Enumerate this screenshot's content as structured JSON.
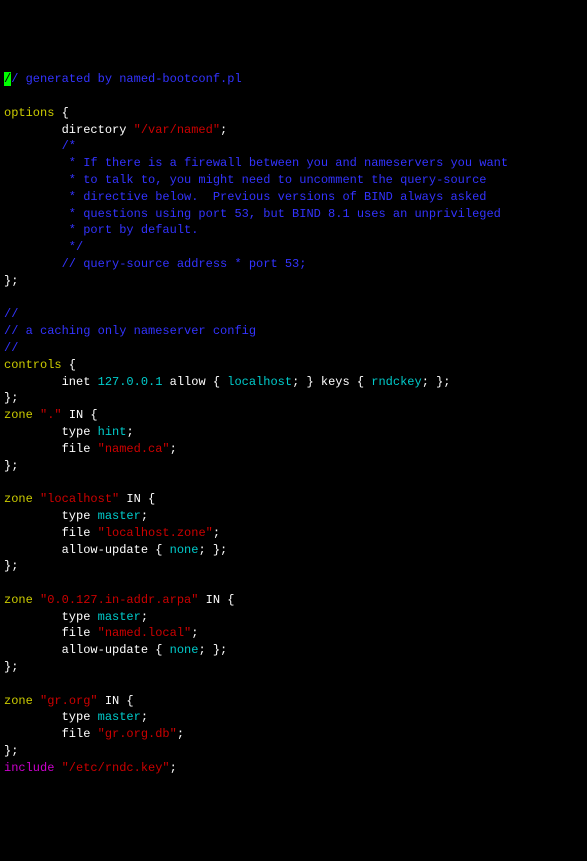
{
  "l1": {
    "cursor": "/",
    "rest": "/ generated by named-bootconf.pl"
  },
  "l2": "",
  "l3": {
    "a": "options",
    "b": " {"
  },
  "l4": {
    "a": "        directory ",
    "b": "\"/var/named\"",
    "c": ";"
  },
  "l5": "        /*",
  "l6": "         * If there is a firewall between you and nameservers you want",
  "l7": "         * to talk to, you might need to uncomment the query-source",
  "l8": "         * directive below.  Previous versions of BIND always asked",
  "l9": "         * questions using port 53, but BIND 8.1 uses an unprivileged",
  "l10": "         * port by default.",
  "l11": "         */",
  "l12": "        // query-source address * port 53;",
  "l13": "};",
  "l14": "",
  "l15": "//",
  "l16": "// a caching only nameserver config",
  "l17": "//",
  "l18": {
    "a": "controls",
    "b": " {"
  },
  "l19": {
    "indent": "        inet ",
    "a": "127.0.0.1",
    "b": " allow { ",
    "c": "localhost",
    "d": "; } keys { ",
    "e": "rndckey",
    "f": "; };"
  },
  "l20": "};",
  "l21": {
    "a": "zone ",
    "b": "\".\"",
    "c": " IN {"
  },
  "l22": {
    "a": "        type ",
    "b": "hint",
    "c": ";"
  },
  "l23": {
    "a": "        file ",
    "b": "\"named.ca\"",
    "c": ";"
  },
  "l24": "};",
  "l25": "",
  "l26": {
    "a": "zone ",
    "b": "\"localhost\"",
    "c": " IN {"
  },
  "l27": {
    "a": "        type ",
    "b": "master",
    "c": ";"
  },
  "l28": {
    "a": "        file ",
    "b": "\"localhost.zone\"",
    "c": ";"
  },
  "l29": {
    "a": "        allow-update { ",
    "b": "none",
    "c": "; };"
  },
  "l30": "};",
  "l31": "",
  "l32": {
    "a": "zone ",
    "b": "\"0.0.127.in-addr.arpa\"",
    "c": " IN {"
  },
  "l33": {
    "a": "        type ",
    "b": "master",
    "c": ";"
  },
  "l34": {
    "a": "        file ",
    "b": "\"named.local\"",
    "c": ";"
  },
  "l35": {
    "a": "        allow-update { ",
    "b": "none",
    "c": "; };"
  },
  "l36": "};",
  "l37": "",
  "l38": {
    "a": "zone ",
    "b": "\"gr.org\"",
    "c": " IN {"
  },
  "l39": {
    "a": "        type ",
    "b": "master",
    "c": ";"
  },
  "l40": {
    "a": "        file ",
    "b": "\"gr.org.db\"",
    "c": ";"
  },
  "l41": "};",
  "l42": {
    "a": "include ",
    "b": "\"/etc/rndc.key\"",
    "c": ";"
  }
}
